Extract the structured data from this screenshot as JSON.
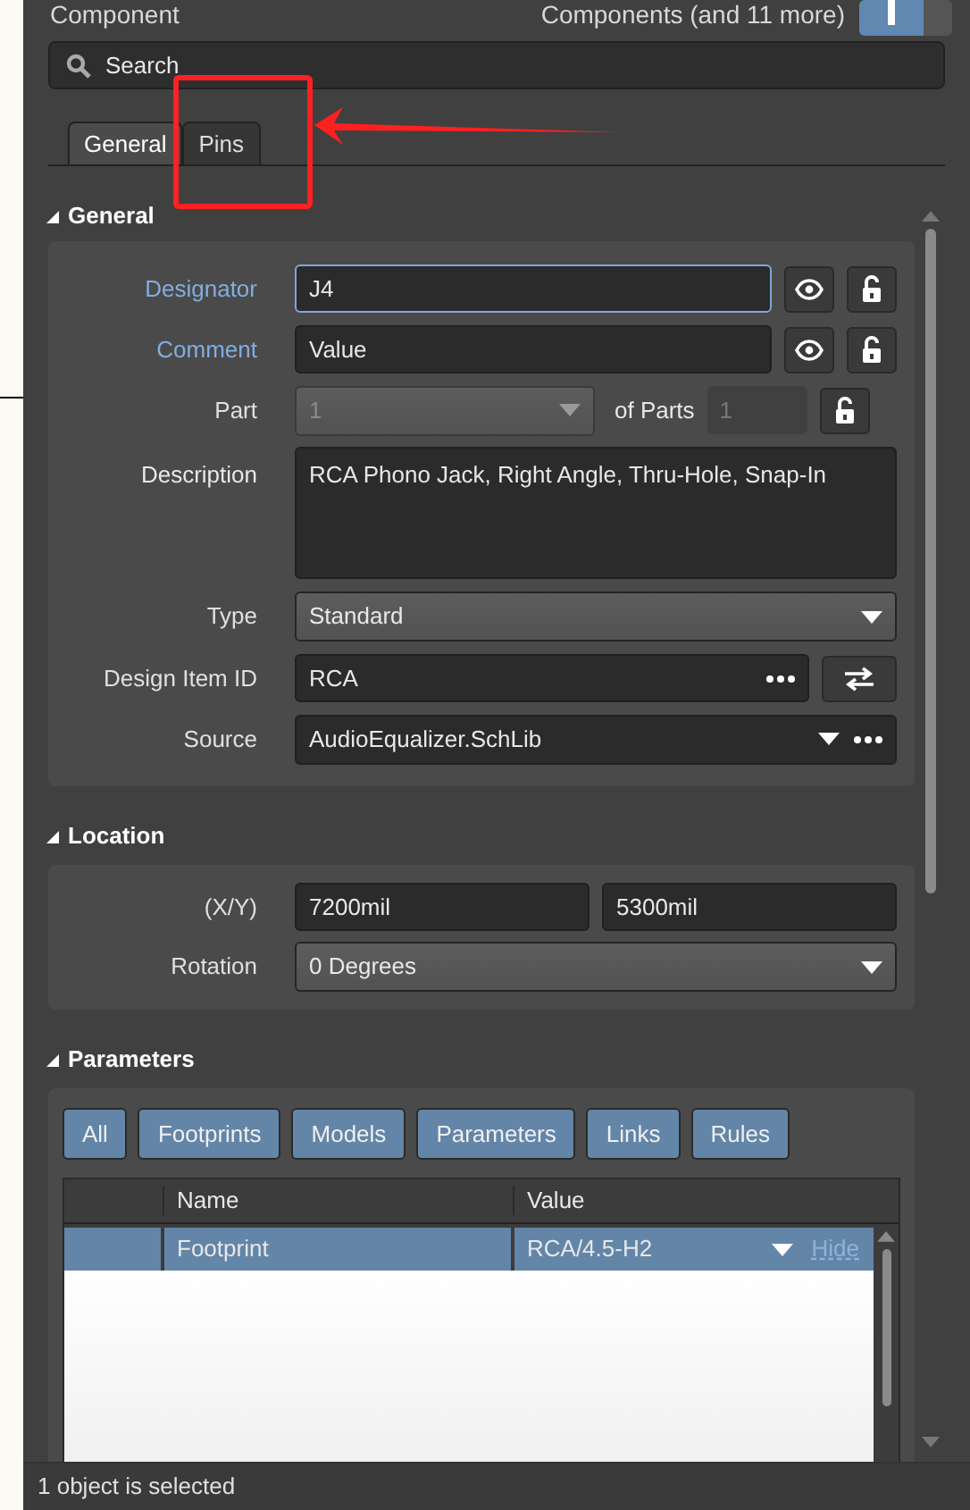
{
  "header": {
    "title": "Component",
    "summary": "Components (and 11 more)"
  },
  "search": {
    "placeholder": "Search"
  },
  "tabs": [
    {
      "label": "General",
      "selected": true
    },
    {
      "label": "Pins",
      "selected": false
    }
  ],
  "general": {
    "title": "General",
    "expanded": true,
    "designator": {
      "label": "Designator",
      "value": "J4"
    },
    "comment": {
      "label": "Comment",
      "value": "Value"
    },
    "part": {
      "label": "Part",
      "value": "1",
      "of_label": "of Parts",
      "of_value": "1"
    },
    "description": {
      "label": "Description",
      "value": "RCA Phono Jack, Right Angle, Thru-Hole, Snap-In"
    },
    "type": {
      "label": "Type",
      "value": "Standard"
    },
    "design_item_id": {
      "label": "Design Item ID",
      "value": "RCA"
    },
    "source": {
      "label": "Source",
      "value": "AudioEqualizer.SchLib"
    }
  },
  "location": {
    "title": "Location",
    "expanded": true,
    "xy_label": "(X/Y)",
    "x": "7200mil",
    "y": "5300mil",
    "rotation_label": "Rotation",
    "rotation": "0 Degrees"
  },
  "parameters": {
    "title": "Parameters",
    "expanded": true,
    "filters": [
      "All",
      "Footprints",
      "Models",
      "Parameters",
      "Links",
      "Rules"
    ],
    "columns": [
      "Name",
      "Value"
    ],
    "rows": [
      {
        "name": "Footprint",
        "value": "RCA/4.5-H2",
        "action": "Hide",
        "selected": true
      }
    ]
  },
  "status_bar": "1 object is selected"
}
